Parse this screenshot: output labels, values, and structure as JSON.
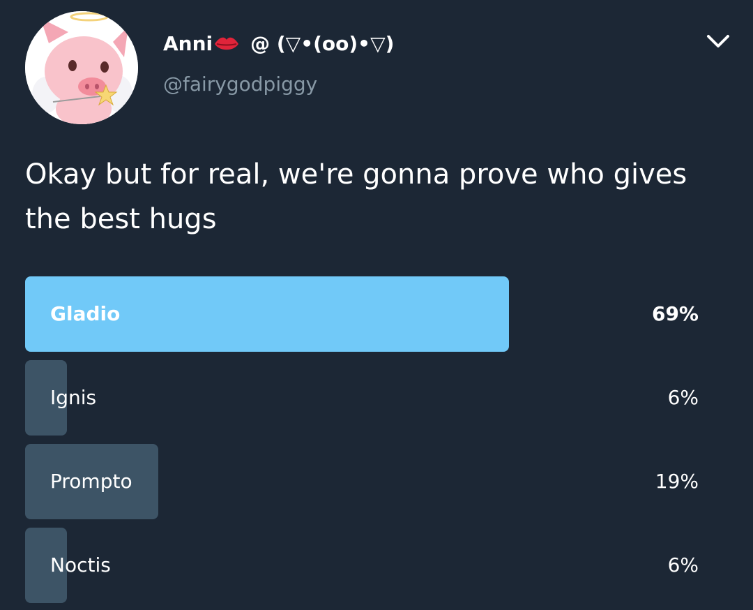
{
  "user": {
    "display_name": "Anni",
    "display_name_suffix": "@ (▽•(oo)•▽)",
    "handle": "@fairygodpiggy",
    "avatar_icon": "pig-avatar-icon",
    "emoji_icon": "lips-icon"
  },
  "tweet": {
    "text": "Okay but for real, we're gonna prove who gives the best hugs"
  },
  "poll": {
    "options": [
      {
        "label": "Gladio",
        "percent_label": "69%",
        "percent": 69
      },
      {
        "label": "Ignis",
        "percent_label": "6%",
        "percent": 6
      },
      {
        "label": "Prompto",
        "percent_label": "19%",
        "percent": 19
      },
      {
        "label": "Noctis",
        "percent_label": "6%",
        "percent": 6
      }
    ]
  },
  "colors": {
    "background": "#1c2735",
    "leader_bar": "#71c9f8",
    "other_bar": "#3d5466",
    "handle": "#8899a6"
  }
}
